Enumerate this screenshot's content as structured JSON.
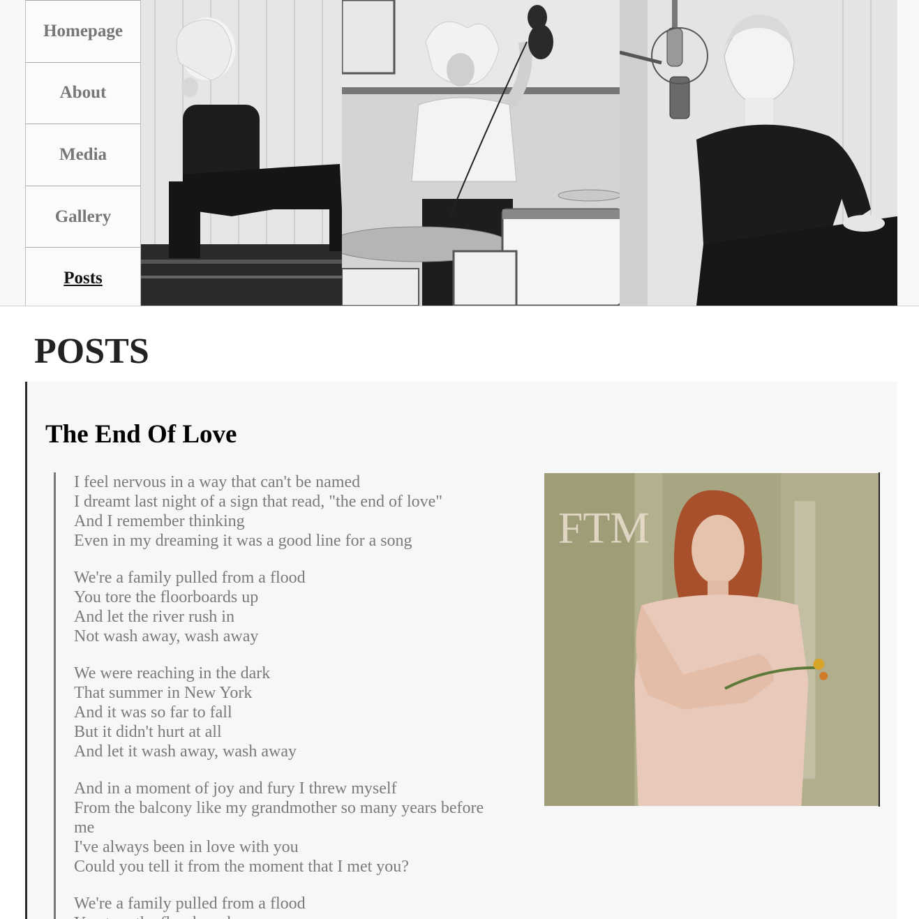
{
  "nav": {
    "items": [
      {
        "label": "Homepage",
        "active": false
      },
      {
        "label": "About",
        "active": false
      },
      {
        "label": "Media",
        "active": false
      },
      {
        "label": "Gallery",
        "active": false
      },
      {
        "label": "Posts",
        "active": true
      }
    ]
  },
  "hero": {
    "images": [
      "photo-piano-icon",
      "photo-drums-icon",
      "photo-microphone-icon"
    ]
  },
  "main": {
    "page_title": "POSTS",
    "post": {
      "title": "The End Of Love",
      "stanzas": [
        [
          "I feel nervous in a way that can't be named",
          "I dreamt last night of a sign that read, \"the end of love\"",
          "And I remember thinking",
          "Even in my dreaming it was a good line for a song"
        ],
        [
          "We're a family pulled from a flood",
          "You tore the floorboards up",
          "And let the river rush in",
          "Not wash away, wash away"
        ],
        [
          "We were reaching in the dark",
          "That summer in New York",
          "And it was so far to fall",
          "But it didn't hurt at all",
          "And let it wash away, wash away"
        ],
        [
          "And in a moment of joy and fury I threw myself",
          "From the balcony like my grandmother so many years before me",
          "I've always been in love with you",
          "Could you tell it from the moment that I met you?"
        ],
        [
          "We're a family pulled from a flood",
          "You tore the floorboards up"
        ]
      ],
      "album_image": "album-cover-icon",
      "album_monogram": "FTM"
    }
  },
  "colors": {
    "nav_text": "#777777",
    "nav_active": "#111111",
    "lyrics_text": "#7a7a7a",
    "post_bg": "#f7f7f7"
  }
}
